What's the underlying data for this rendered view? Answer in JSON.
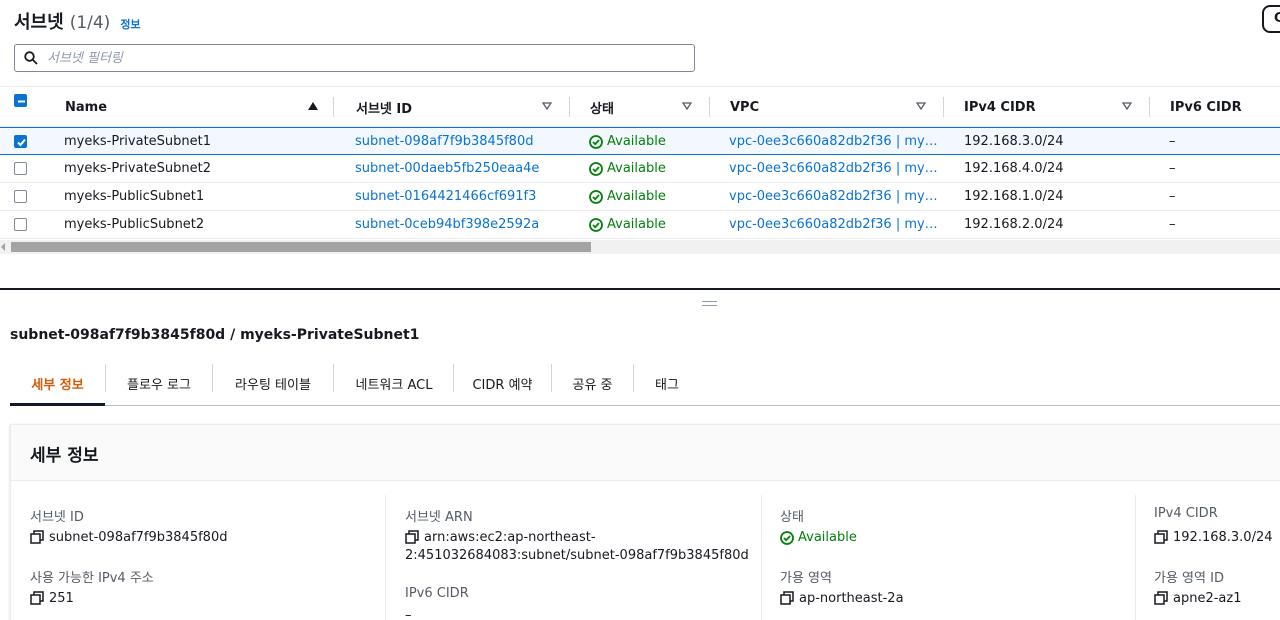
{
  "header": {
    "title": "서브넷",
    "count": "(1/4)",
    "info": "정보",
    "right_button": "C"
  },
  "filter": {
    "placeholder": "서브넷 필터링"
  },
  "columns": [
    "Name",
    "서브넷 ID",
    "상태",
    "VPC",
    "IPv4 CIDR",
    "IPv6 CIDR"
  ],
  "rows": [
    {
      "name": "myeks-PrivateSubnet1",
      "subnet_id": "subnet-098af7f9b3845f80d",
      "status": "Available",
      "vpc": "vpc-0ee3c660a82db2f36 | my…",
      "ipv4": "192.168.3.0/24",
      "ipv6": "–",
      "selected": true
    },
    {
      "name": "myeks-PrivateSubnet2",
      "subnet_id": "subnet-00daeb5fb250eaa4e",
      "status": "Available",
      "vpc": "vpc-0ee3c660a82db2f36 | my…",
      "ipv4": "192.168.4.0/24",
      "ipv6": "–",
      "selected": false
    },
    {
      "name": "myeks-PublicSubnet1",
      "subnet_id": "subnet-0164421466cf691f3",
      "status": "Available",
      "vpc": "vpc-0ee3c660a82db2f36 | my…",
      "ipv4": "192.168.1.0/24",
      "ipv6": "–",
      "selected": false
    },
    {
      "name": "myeks-PublicSubnet2",
      "subnet_id": "subnet-0ceb94bf398e2592a",
      "status": "Available",
      "vpc": "vpc-0ee3c660a82db2f36 | my…",
      "ipv4": "192.168.2.0/24",
      "ipv6": "–",
      "selected": false
    }
  ],
  "detail": {
    "title": "subnet-098af7f9b3845f80d / myeks-PrivateSubnet1",
    "tabs": [
      "세부 정보",
      "플로우 로그",
      "라우팅 테이블",
      "네트워크 ACL",
      "CIDR 예약",
      "공유 중",
      "태그"
    ],
    "panel_title": "세부 정보",
    "fields": {
      "subnet_id_label": "서브넷 ID",
      "subnet_id_value": "subnet-098af7f9b3845f80d",
      "available_ipv4_label": "사용 가능한 IPv4 주소",
      "available_ipv4_value": "251",
      "arn_label": "서브넷 ARN",
      "arn_value_line1": "arn:aws:ec2:ap-northeast-",
      "arn_value_line2": "2:451032684083:subnet/subnet-098af7f9b3845f80d",
      "ipv6_cidr_label": "IPv6 CIDR",
      "ipv6_cidr_value": "–",
      "state_label": "상태",
      "state_value": "Available",
      "az_label": "가용 영역",
      "az_value": "ap-northeast-2a",
      "ipv4_cidr_label": "IPv4 CIDR",
      "ipv4_cidr_value": "192.168.3.0/24",
      "az_id_label": "가용 영역 ID",
      "az_id_value": "apne2-az1"
    }
  },
  "colors": {
    "link": "#0972d3",
    "success": "#037f0c",
    "active_tab": "#d45b07"
  }
}
